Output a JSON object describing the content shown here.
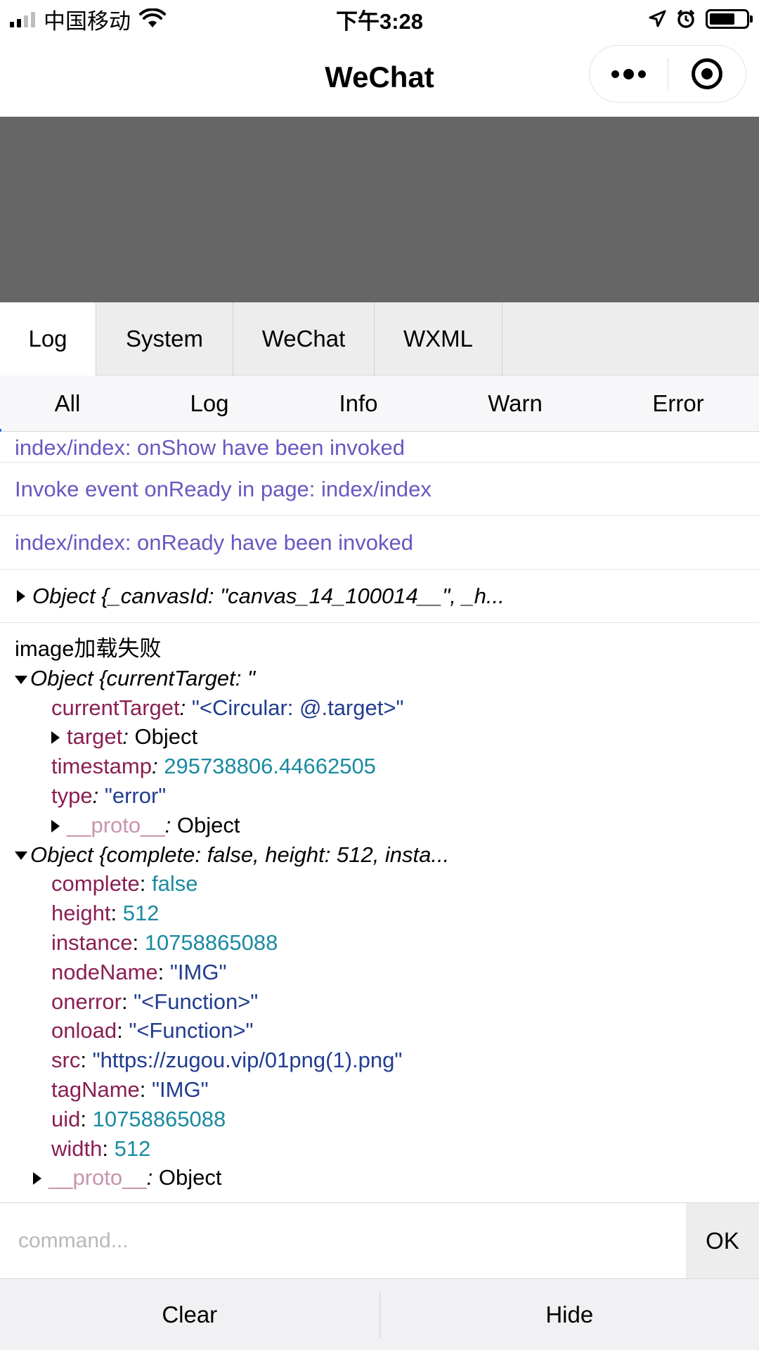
{
  "status_bar": {
    "carrier": "中国移动",
    "time": "下午3:28"
  },
  "title_bar": {
    "title": "WeChat"
  },
  "panel_tabs": [
    {
      "label": "Log",
      "active": true
    },
    {
      "label": "System",
      "active": false
    },
    {
      "label": "WeChat",
      "active": false
    },
    {
      "label": "WXML",
      "active": false
    }
  ],
  "filter_tabs": [
    {
      "label": "All",
      "active": true
    },
    {
      "label": "Log",
      "active": false
    },
    {
      "label": "Info",
      "active": false
    },
    {
      "label": "Warn",
      "active": false
    },
    {
      "label": "Error",
      "active": false
    }
  ],
  "logs": {
    "partial_row": "index/index: onShow have been invoked",
    "row_ready_event": "Invoke event onReady in page: index/index",
    "row_ready_invoked": "index/index: onReady have been invoked",
    "collapsed_object": "Object {_canvasId: \"canvas_14_100014__\", _h...",
    "message": "image加载失败",
    "event_object": {
      "summary": "Object {currentTarget: \"",
      "currentTarget_key": "currentTarget",
      "currentTarget_value": "\"<Circular: @.target>\"",
      "target_key": "target",
      "target_value": "Object",
      "timestamp_key": "timestamp",
      "timestamp_value": "295738806.44662505",
      "type_key": "type",
      "type_value": "\"error\"",
      "proto_key": "__proto__",
      "proto_value": "Object"
    },
    "image_object": {
      "summary": "Object {complete: false, height: 512, insta...",
      "complete_key": "complete",
      "complete_value": "false",
      "height_key": "height",
      "height_value": "512",
      "instance_key": "instance",
      "instance_value": "10758865088",
      "nodeName_key": "nodeName",
      "nodeName_value": "\"IMG\"",
      "onerror_key": "onerror",
      "onerror_value": "\"<Function>\"",
      "onload_key": "onload",
      "onload_value": "\"<Function>\"",
      "src_key": "src",
      "src_value": "\"https://zugou.vip/01png(1).png\"",
      "tagName_key": "tagName",
      "tagName_value": "\"IMG\"",
      "uid_key": "uid",
      "uid_value": "10758865088",
      "width_key": "width",
      "width_value": "512",
      "proto_key": "__proto__",
      "proto_value": "Object"
    }
  },
  "command": {
    "placeholder": "command...",
    "ok_label": "OK"
  },
  "bottom": {
    "clear_label": "Clear",
    "hide_label": "Hide"
  }
}
